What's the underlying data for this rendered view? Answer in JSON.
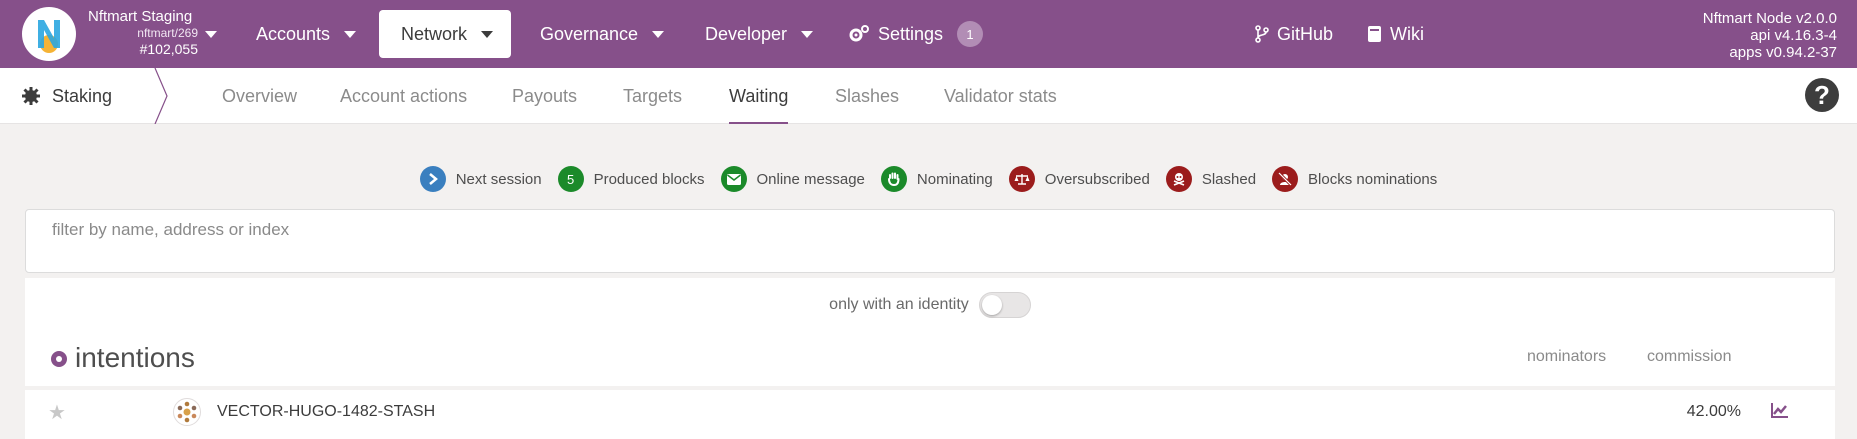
{
  "topbar": {
    "chain_name": "Nftmart Staging",
    "chain_spec": "nftmart/269",
    "block_number": "#102,055",
    "menu": [
      {
        "label": "Accounts"
      },
      {
        "label": "Network"
      },
      {
        "label": "Governance"
      },
      {
        "label": "Developer"
      },
      {
        "label": "Settings",
        "badge": "1"
      }
    ],
    "links": [
      {
        "label": "GitHub"
      },
      {
        "label": "Wiki"
      }
    ],
    "node": {
      "line1": "Nftmart Node v2.0.0",
      "line2": "api v4.16.3-4",
      "line3": "apps v0.94.2-37"
    },
    "brand_color": "#86508a"
  },
  "subnav": {
    "section": "Staking",
    "tabs": [
      {
        "label": "Overview"
      },
      {
        "label": "Account actions"
      },
      {
        "label": "Payouts"
      },
      {
        "label": "Targets"
      },
      {
        "label": "Waiting",
        "active": true
      },
      {
        "label": "Slashes"
      },
      {
        "label": "Validator stats"
      }
    ],
    "help_glyph": "?"
  },
  "legend": [
    {
      "label": "Next session",
      "icon": "chevron-right-icon",
      "color": "#3a7fbf"
    },
    {
      "label": "Produced blocks",
      "icon_text": "5",
      "color": "#1b8a2a"
    },
    {
      "label": "Online message",
      "icon": "envelope-icon",
      "color": "#1b8a2a"
    },
    {
      "label": "Nominating",
      "icon": "hand-icon",
      "color": "#1b8a2a"
    },
    {
      "label": "Oversubscribed",
      "icon": "balance-scale-icon",
      "color": "#9b1c1c"
    },
    {
      "label": "Slashed",
      "icon": "skull-icon",
      "color": "#9b1c1c"
    },
    {
      "label": "Blocks nominations",
      "icon": "user-slash-icon",
      "color": "#9b1c1c"
    }
  ],
  "filter": {
    "placeholder": "filter by name, address or index"
  },
  "toggle": {
    "label": "only with an identity",
    "checked": false
  },
  "list": {
    "title": "intentions",
    "columns": {
      "nominators": "nominators",
      "commission": "commission"
    },
    "rows": [
      {
        "name": "VECTOR-HUGO-1482-STASH",
        "commission": "42.00%"
      }
    ]
  }
}
